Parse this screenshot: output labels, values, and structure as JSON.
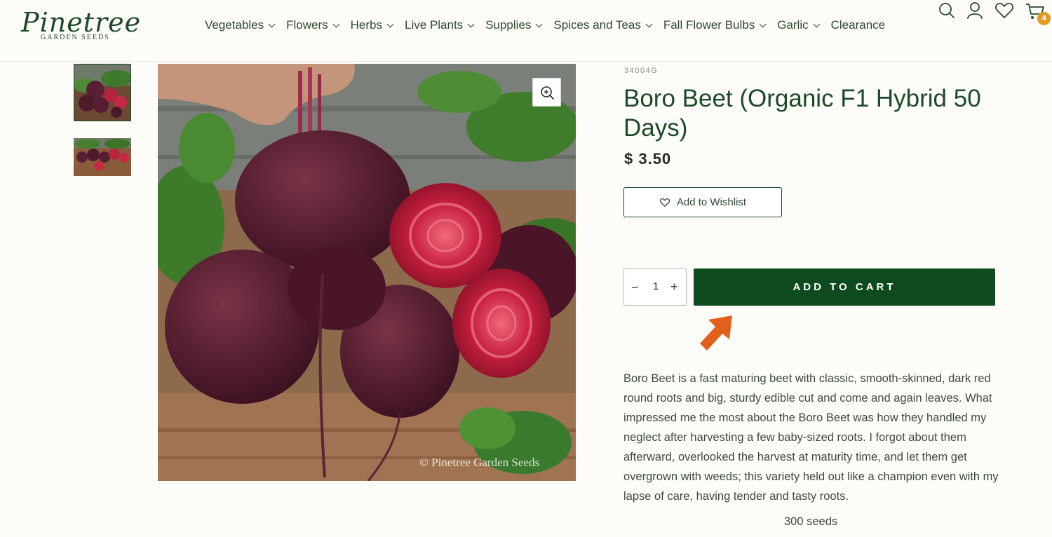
{
  "header": {
    "logo_text": "Pinetree",
    "logo_subtext": "GARDEN SEEDS",
    "nav": [
      {
        "label": "Vegetables"
      },
      {
        "label": "Flowers"
      },
      {
        "label": "Herbs"
      },
      {
        "label": "Live Plants"
      },
      {
        "label": "Supplies"
      },
      {
        "label": "Spices and Teas"
      },
      {
        "label": "Fall Flower Bulbs"
      },
      {
        "label": "Garlic"
      },
      {
        "label": "Clearance"
      }
    ],
    "icons": [
      "search-icon",
      "account-icon",
      "heart-icon",
      "cart-icon"
    ],
    "cart_count": "4"
  },
  "gallery": {
    "watermark": "© Pinetree Garden Seeds",
    "thumbnails": 2
  },
  "product": {
    "sku": "34004G",
    "title": "Boro Beet (Organic F1 Hybrid 50 Days)",
    "price": "$ 3.50",
    "wishlist_label": "Add to Wishlist",
    "quantity": "1",
    "qty_minus": "−",
    "qty_plus": "+",
    "add_to_cart_label": "ADD TO CART",
    "description": "Boro Beet is a fast maturing beet with classic, smooth-skinned, dark red round roots and big, sturdy edible cut and come and again leaves. What impressed me the most about the Boro Beet was how they handled my neglect after harvesting a few baby-sized roots. I forgot about them afterward, overlooked the harvest at maturity time, and let them get overgrown with weeds; this variety held out like a champion even with my lapse of care, having tender and tasty roots.",
    "seed_count": "300 seeds"
  },
  "colors": {
    "brand_green": "#0d4a1e",
    "badge_orange": "#e39a22",
    "arrow_orange": "#e2611a"
  }
}
